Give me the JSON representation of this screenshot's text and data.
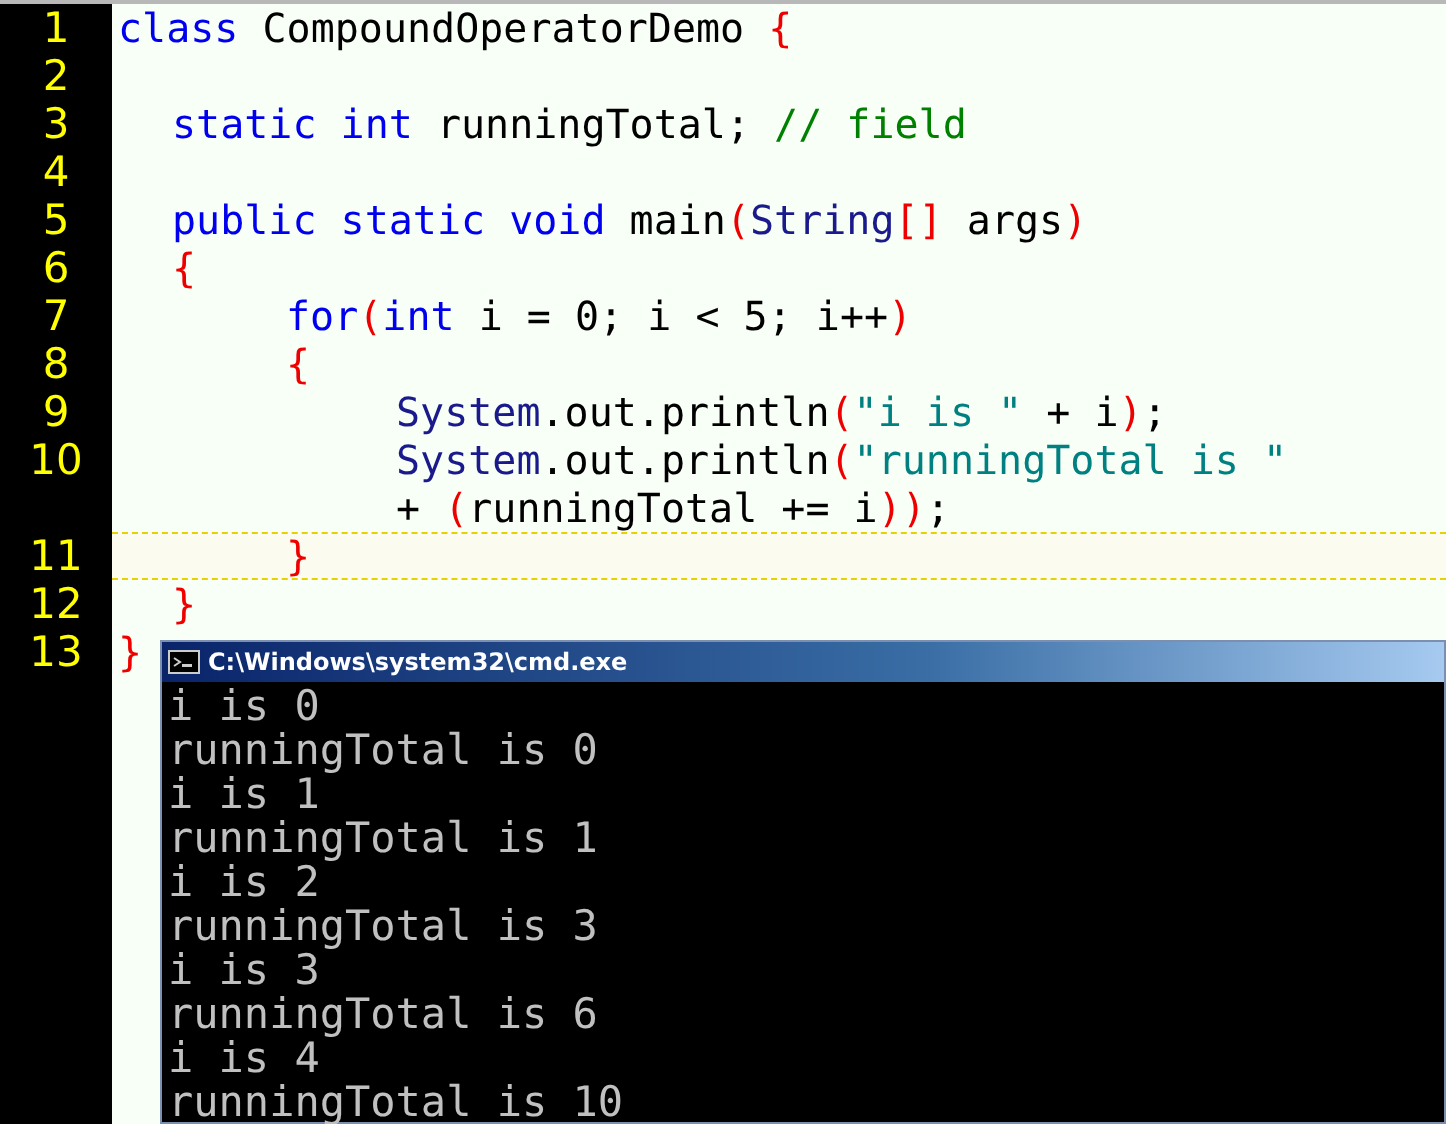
{
  "editor": {
    "lines": [
      {
        "number": "1",
        "current": false,
        "kind": "none",
        "tokens": [
          {
            "kind": "keyword",
            "text": "class"
          },
          {
            "kind": "plain",
            "text": " CompoundOperatorDemo "
          },
          {
            "kind": "bracket",
            "text": "{"
          }
        ]
      },
      {
        "number": "2",
        "current": false
      },
      {
        "number": "3",
        "current": false,
        "kind": "member",
        "tokens": [
          {
            "kind": "keyword",
            "text": "static int"
          },
          {
            "kind": "plain",
            "text": " runningTotal; "
          },
          {
            "kind": "comment",
            "text": "// field"
          }
        ]
      },
      {
        "number": "4",
        "current": false
      },
      {
        "number": "5",
        "current": false,
        "kind": "member",
        "tokens": [
          {
            "kind": "keyword",
            "text": "public static void"
          },
          {
            "kind": "plain",
            "text": " main"
          },
          {
            "kind": "bracket",
            "text": "("
          },
          {
            "kind": "type",
            "text": "String"
          },
          {
            "kind": "bracket",
            "text": "[]"
          },
          {
            "kind": "plain",
            "text": " args"
          },
          {
            "kind": "bracket",
            "text": ")"
          }
        ]
      },
      {
        "number": "6",
        "current": false,
        "kind": "member",
        "tokens": [
          {
            "kind": "bracket",
            "text": "{"
          }
        ]
      },
      {
        "number": "7",
        "current": false,
        "kind": "body",
        "tokens": [
          {
            "kind": "keyword",
            "text": "for"
          },
          {
            "kind": "bracket",
            "text": "("
          },
          {
            "kind": "keyword",
            "text": "int"
          },
          {
            "kind": "plain",
            "text": " i = 0; i < 5; i++"
          },
          {
            "kind": "bracket",
            "text": ")"
          }
        ]
      },
      {
        "number": "8",
        "current": false,
        "kind": "body",
        "tokens": [
          {
            "kind": "bracket",
            "text": "{"
          }
        ]
      },
      {
        "number": "9",
        "current": false,
        "kind": "statement",
        "tokens": [
          {
            "kind": "type",
            "text": "System"
          },
          {
            "kind": "plain",
            "text": ".out.println"
          },
          {
            "kind": "bracket",
            "text": "("
          },
          {
            "kind": "string",
            "text": "\"i is \""
          },
          {
            "kind": "plain",
            "text": " + i"
          },
          {
            "kind": "bracket",
            "text": ")"
          },
          {
            "kind": "plain",
            "text": ";"
          }
        ]
      },
      {
        "number": "10",
        "current": false,
        "kind": "statement",
        "tokens": [
          {
            "kind": "type",
            "text": "System"
          },
          {
            "kind": "plain",
            "text": ".out.println"
          },
          {
            "kind": "bracket",
            "text": "("
          },
          {
            "kind": "string",
            "text": "\"runningTotal is \""
          }
        ]
      },
      {
        "current": false,
        "kind": "statement",
        "tokens": [
          {
            "kind": "plain",
            "text": "+ "
          },
          {
            "kind": "bracket",
            "text": "("
          },
          {
            "kind": "plain",
            "text": "runningTotal += i"
          },
          {
            "kind": "bracket",
            "text": "))"
          },
          {
            "kind": "plain",
            "text": ";"
          }
        ]
      },
      {
        "number": "11",
        "current": true,
        "kind": "body",
        "tokens": [
          {
            "kind": "bracket",
            "text": "}"
          }
        ]
      },
      {
        "number": "12",
        "current": false,
        "kind": "member",
        "tokens": [
          {
            "kind": "bracket",
            "text": "}"
          }
        ]
      },
      {
        "number": "13",
        "current": false,
        "kind": "none",
        "tokens": [
          {
            "kind": "bracket",
            "text": "}"
          }
        ]
      }
    ]
  },
  "console": {
    "title": "C:\\Windows\\system32\\cmd.exe",
    "output": [
      "i is 0",
      "runningTotal is 0",
      "i is 1",
      "runningTotal is 1",
      "i is 2",
      "runningTotal is 3",
      "i is 3",
      "runningTotal is 6",
      "i is 4",
      "runningTotal is 10"
    ]
  }
}
